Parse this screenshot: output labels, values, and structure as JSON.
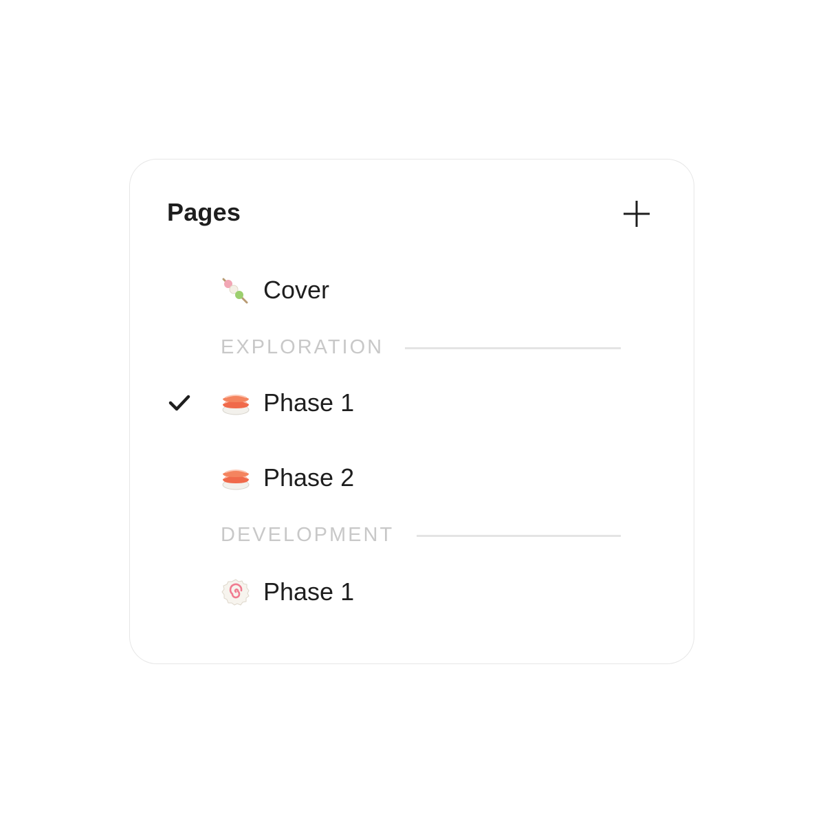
{
  "panel": {
    "title": "Pages",
    "add_icon": "plus-icon"
  },
  "pages": [
    {
      "label": "Cover",
      "icon": "dango-icon",
      "selected": false
    },
    {
      "label": "Phase 1",
      "icon": "sushi-icon",
      "selected": true,
      "section": "EXPLORATION"
    },
    {
      "label": "Phase 2",
      "icon": "sushi-icon",
      "selected": false,
      "section": "EXPLORATION"
    },
    {
      "label": "Phase 1",
      "icon": "narutomaki-icon",
      "selected": false,
      "section": "DEVELOPMENT"
    }
  ],
  "sections": [
    {
      "label": "EXPLORATION"
    },
    {
      "label": "DEVELOPMENT"
    }
  ],
  "colors": {
    "text": "#1e1e1e",
    "section_text": "#c8c8c8",
    "divider": "#e4e4e4",
    "border": "#e6e6e6"
  }
}
